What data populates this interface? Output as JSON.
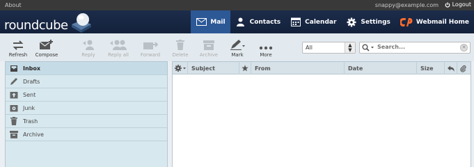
{
  "topline": {
    "about": "About",
    "user_email": "snappy@example.com",
    "logout": "Logout"
  },
  "app": {
    "logo_text": "roundcube"
  },
  "nav": [
    {
      "label": "Mail",
      "icon": "mail-icon",
      "active": true
    },
    {
      "label": "Contacts",
      "icon": "contacts-icon"
    },
    {
      "label": "Calendar",
      "icon": "calendar-icon"
    },
    {
      "label": "Settings",
      "icon": "settings-icon"
    },
    {
      "label": "Webmail Home",
      "icon": "cpanel-icon"
    }
  ],
  "toolbar": {
    "refresh": "Refresh",
    "compose": "Compose",
    "reply": "Reply",
    "reply_all": "Reply all",
    "forward": "Forward",
    "delete": "Delete",
    "archive": "Archive",
    "mark": "Mark",
    "more": "More"
  },
  "filter": {
    "selected": "All"
  },
  "search": {
    "placeholder": "Search..."
  },
  "folders": [
    {
      "label": "Inbox",
      "icon": "inbox-icon",
      "selected": true
    },
    {
      "label": "Drafts",
      "icon": "drafts-icon"
    },
    {
      "label": "Sent",
      "icon": "sent-icon"
    },
    {
      "label": "Junk",
      "icon": "junk-icon"
    },
    {
      "label": "Trash",
      "icon": "trash-icon"
    },
    {
      "label": "Archive",
      "icon": "archive-icon"
    }
  ],
  "message_list": {
    "columns": {
      "subject": "Subject",
      "from": "From",
      "date": "Date",
      "size": "Size"
    },
    "rows": []
  },
  "colors": {
    "header_bg": "#13213b",
    "nav_active": "#2c5896",
    "folder_selected": "#c5dce7"
  }
}
